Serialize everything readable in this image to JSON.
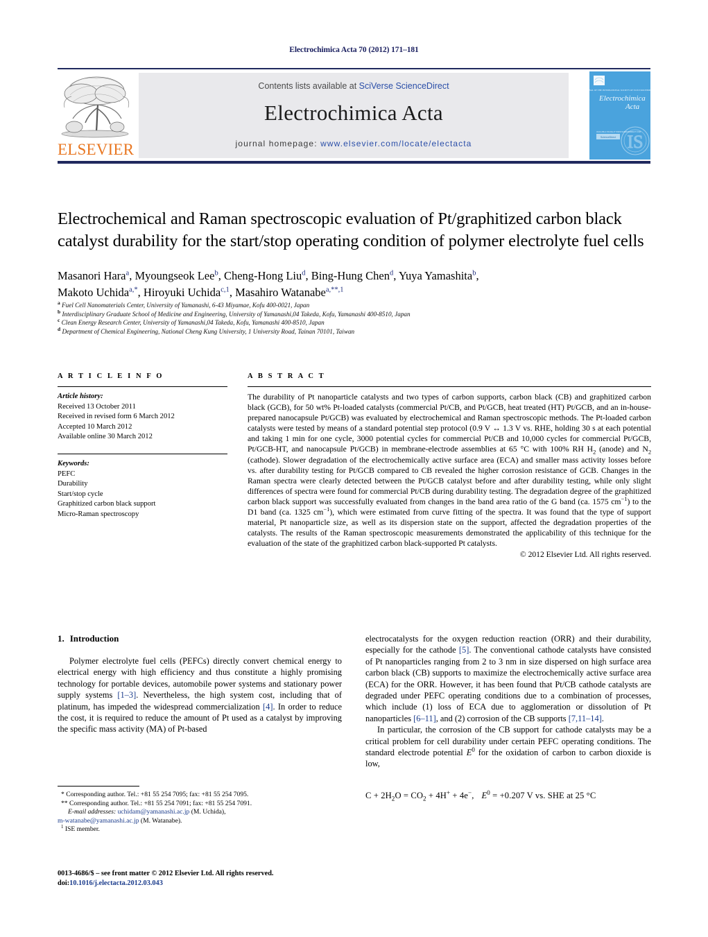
{
  "running_head": "Electrochimica Acta 70 (2012) 171–181",
  "masthead": {
    "contents_prefix": "Contents lists available at ",
    "sciencedirect": "SciVerse ScienceDirect",
    "journal_title": "Electrochimica Acta",
    "homepage_prefix": "journal homepage: ",
    "homepage_url": "www.elsevier.com/locate/electacta",
    "publisher": "ELSEVIER",
    "cover_title_line1": "Electrochimica",
    "cover_title_line2": "Acta",
    "accent_orange": "#E87722",
    "accent_blue": "#2a4ea8",
    "rule_navy": "#20295e",
    "cover_blue": "#4aa3dd"
  },
  "article": {
    "title": "Electrochemical and Raman spectroscopic evaluation of Pt/graphitized carbon black catalyst durability for the start/stop operating condition of polymer electrolyte fuel cells",
    "authors_line1": "Masanori Hara<sup>a</sup>, Myoungseok Lee<sup>b</sup>, Cheng-Hong Liu<sup>d</sup>, Bing-Hung Chen<sup>d</sup>, Yuya Yamashita<sup>b</sup>,",
    "authors_line2": "Makoto Uchida<sup>a,*</sup>, Hiroyuki Uchida<sup>c,1</sup>, Masahiro Watanabe<sup>a,**,1</sup>",
    "affiliations": [
      "<sup>a</sup> Fuel Cell Nanomaterials Center, University of Yamanashi, 6-43 Miyamae, Kofu 400-0021, Japan",
      "<sup>b</sup> Interdisciplinary Graduate School of Medicine and Engineering, University of Yamanashi,04 Takeda, Kofu, Yamanashi 400-8510, Japan",
      "<sup>c</sup> Clean Energy Research Center, University of Yamanashi,04 Takeda, Kofu, Yamanashi 400-8510, Japan",
      "<sup>d</sup> Department of Chemical Engineering, National Cheng Kung University, 1 University Road, Tainan 70101, Taiwan"
    ]
  },
  "article_info": {
    "heading": "A R T I C L E    I N F O",
    "history_label": "Article history:",
    "history": [
      "Received 13 October 2011",
      "Received in revised form 6 March 2012",
      "Accepted 10 March 2012",
      "Available online 30 March 2012"
    ],
    "keywords_label": "Keywords:",
    "keywords": [
      "PEFC",
      "Durability",
      "Start/stop cycle",
      "Graphitized carbon black support",
      "Micro-Raman spectroscopy"
    ]
  },
  "abstract": {
    "heading": "A B S T R A C T",
    "text": "The durability of Pt nanoparticle catalysts and two types of carbon supports, carbon black (CB) and graphitized carbon black (GCB), for 50 wt% Pt-loaded catalysts (commercial Pt/CB, and Pt/GCB, heat treated (HT) Pt/GCB, and an in-house-prepared nanocapsule Pt/GCB) was evaluated by electrochemical and Raman spectroscopic methods. The Pt-loaded carbon catalysts were tested by means of a standard potential step protocol (0.9 V &#8596; 1.3 V vs. RHE, holding 30 s at each potential and taking 1 min for one cycle, 3000 potential cycles for commercial Pt/CB and 10,000 cycles for commercial Pt/GCB, Pt/GCB-HT, and nanocapsule Pt/GCB) in membrane-electrode assemblies at 65 &#176;C with 100% RH H<sub>2</sub> (anode) and N<sub>2</sub> (cathode). Slower degradation of the electrochemically active surface area (ECA) and smaller mass activity losses before vs. after durability testing for Pt/GCB compared to CB revealed the higher corrosion resistance of GCB. Changes in the Raman spectra were clearly detected between the Pt/GCB catalyst before and after durability testing, while only slight differences of spectra were found for commercial Pt/CB during durability testing. The degradation degree of the graphitized carbon black support was successfully evaluated from changes in the band area ratio of the G band (ca. 1575 cm<sup>&#8722;1</sup>) to the D1 band (ca. 1325 cm<sup>&#8722;1</sup>), which were estimated from curve fitting of the spectra. It was found that the type of support material, Pt nanoparticle size, as well as its dispersion state on the support, affected the degradation properties of the catalysts. The results of the Raman spectroscopic measurements demonstrated the applicability of this technique for the evaluation of the state of the graphitized carbon black-supported Pt catalysts.",
    "copyright": "&#169; 2012 Elsevier Ltd. All rights reserved."
  },
  "body": {
    "section_number": "1.",
    "section_title": "Introduction",
    "para_left_1": "Polymer electrolyte fuel cells (PEFCs) directly convert chemical energy to electrical energy with high efficiency and thus constitute a highly promising technology for portable devices, automobile power systems and stationary power supply systems <span class=\"ref\">[1&#8211;3]</span>. Nevertheless, the high system cost, including that of platinum, has impeded the widespread commercialization <span class=\"ref\">[4]</span>. In order to reduce the cost, it is required to reduce the amount of Pt used as a catalyst by improving the specific mass activity (MA) of Pt-based",
    "para_right_1": "electrocatalysts for the oxygen reduction reaction (ORR) and their durability, especially for the cathode <span class=\"ref\">[5]</span>. The conventional cathode catalysts have consisted of Pt nanoparticles ranging from 2 to 3 nm in size dispersed on high surface area carbon black (CB) supports to maximize the electrochemically active surface area (ECA) for the ORR. However, it has been found that Pt/CB cathode catalysts are degraded under PEFC operating conditions due to a combination of processes, which include (1) loss of ECA due to agglomeration or dissolution of Pt nanoparticles <span class=\"ref\">[6&#8211;11]</span>, and (2) corrosion of the CB supports <span class=\"ref\">[7,11&#8211;14]</span>.",
    "para_right_2": "In particular, the corrosion of the CB support for cathode catalysts may be a critical problem for cell durability under certain PEFC operating conditions. The standard electrode potential <i>E</i><sup>0</sup> for the oxidation of carbon to carbon dioxide is low,",
    "equation": "C + 2H<sub>2</sub>O  =  CO<sub>2</sub> + 4H<sup>+</sup> + 4e<sup>&#8722;</sup>,<span class=\"sp\"></span><i>E</i><sup>0</sup> =  +0.207 V vs. SHE at 25 &#176;C"
  },
  "footnotes": {
    "corr1": "* Corresponding author. Tel.: +81 55 254 7095; fax: +81 55 254 7095.",
    "corr2": "** Corresponding author. Tel.: +81 55 254 7091; fax: +81 55 254 7091.",
    "email_label": "E-mail addresses:",
    "email1": "uchidam@yamanashi.ac.jp",
    "email1_who": "(M. Uchida),",
    "email2": "m-watanabe@yamanashi.ac.jp",
    "email2_who": "(M. Watanabe).",
    "ise": "<sup>1</sup> ISE member."
  },
  "imprint": {
    "line1": "0013-4686/$ &#8211; see front matter &#169; 2012 Elsevier Ltd. All rights reserved.",
    "doi_label": "doi:",
    "doi": "10.1016/j.electacta.2012.03.043"
  }
}
